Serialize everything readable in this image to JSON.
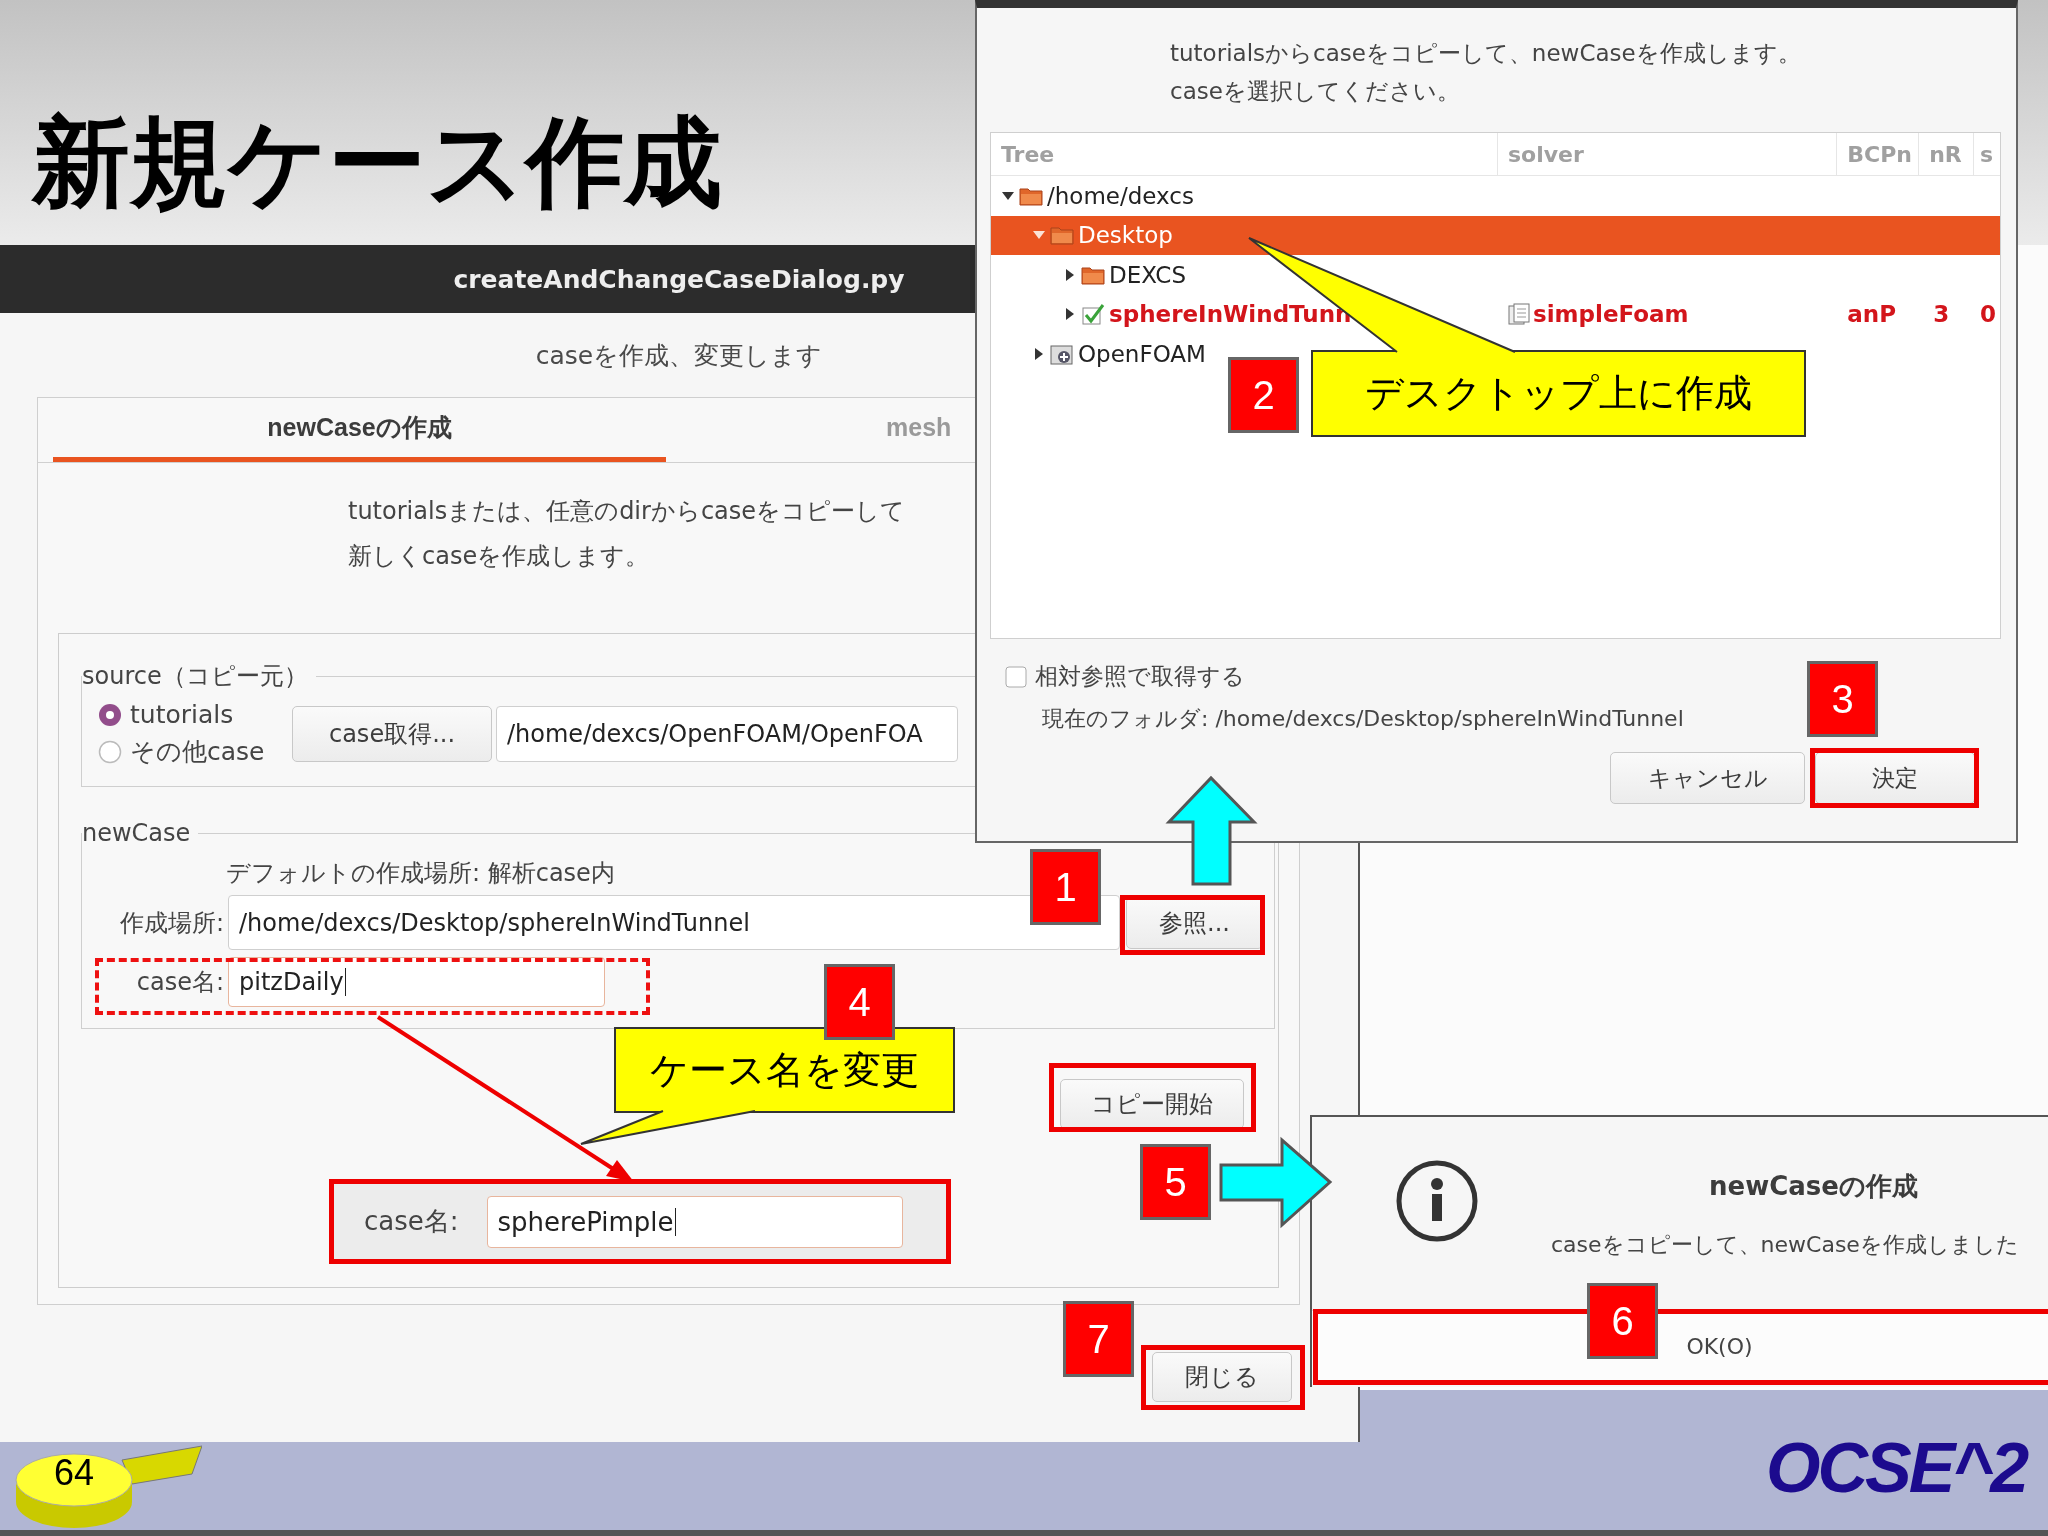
{
  "slide": {
    "title": "新規ケース作成",
    "page_number": "64",
    "logo": "OCSE^2"
  },
  "main_window": {
    "title": "createAndChangeCaseDialog.py",
    "subtitle": "caseを作成、変更します",
    "tabs": [
      {
        "label": "newCaseの作成",
        "selected": true
      },
      {
        "label": "mesh",
        "selected": false
      }
    ],
    "description": [
      "tutorialsまたは、任意のdirからcaseをコピーして",
      "新しくcaseを作成します。"
    ],
    "source": {
      "legend": "source（コピー元）",
      "options": [
        {
          "label": "tutorials",
          "selected": true
        },
        {
          "label": "その他case",
          "selected": false
        }
      ],
      "get_button": "case取得...",
      "path": "/home/dexcs/OpenFOAM/OpenFOA"
    },
    "new_case": {
      "legend": "newCase",
      "hint": "デフォルトの作成場所: 解析case内",
      "location_label": "作成場所:",
      "location": "/home/dexcs/Desktop/sphereInWindTunnel",
      "browse_button": "参照...",
      "name_label": "case名:",
      "name": "pitzDaily"
    },
    "copy_button": "コピー開始",
    "close_button": "閉じる",
    "inset": {
      "label": "case名:",
      "value": "spherePimple"
    }
  },
  "case_dialog": {
    "instructions": [
      "tutorialsからcaseをコピーして、newCaseを作成します。",
      "caseを選択してください。"
    ],
    "columns": [
      "Tree",
      "solver",
      "BCPn",
      "nR",
      "s"
    ],
    "tree": [
      {
        "name": "/home/dexcs",
        "kind": "folder",
        "expanded": true,
        "selected": false,
        "children": [
          {
            "name": "Desktop",
            "kind": "folder",
            "expanded": true,
            "selected": true,
            "children": [
              {
                "name": "DEXCS",
                "kind": "folder",
                "expanded": false,
                "selected": false
              },
              {
                "name": "sphereInWindTunn",
                "kind": "case",
                "expanded": false,
                "selected": false,
                "solver": "simpleFoam",
                "bcpn": "anP",
                "nr": "3",
                "column_5": "0"
              }
            ]
          },
          {
            "name": "OpenFOAM",
            "kind": "package",
            "expanded": false,
            "selected": false
          }
        ]
      }
    ],
    "relative_option": {
      "label": "相対参照で取得する",
      "checked": false
    },
    "current_folder": "現在のフォルダ: /home/dexcs/Desktop/sphereInWindTunnel",
    "buttons": [
      "キャンセル",
      "決定"
    ]
  },
  "message_dialog": {
    "title": "newCaseの作成",
    "message": "caseをコピーして、newCaseを作成しました",
    "button": "OK(O)"
  },
  "annotations": {
    "steps": [
      "1",
      "2",
      "3",
      "4",
      "5",
      "6",
      "7"
    ],
    "callouts": [
      "デスクトップ上に作成",
      "ケース名を変更"
    ]
  }
}
